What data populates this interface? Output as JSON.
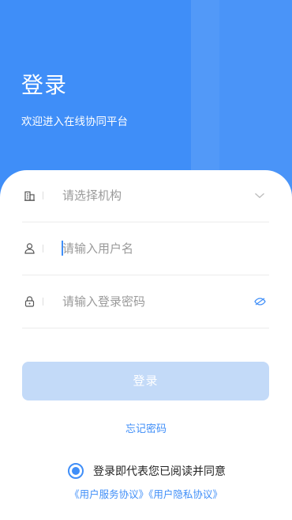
{
  "header": {
    "title": "登录",
    "subtitle": "欢迎进入在线协同平台"
  },
  "form": {
    "org": {
      "placeholder": "请选择机构",
      "icon": "building-icon",
      "trail_icon": "chevron-down-icon"
    },
    "username": {
      "placeholder": "请输入用户名",
      "icon": "user-icon"
    },
    "password": {
      "placeholder": "请输入登录密码",
      "icon": "lock-icon",
      "trail_icon": "eye-closed-icon"
    }
  },
  "actions": {
    "login_label": "登录",
    "forgot_label": "忘记密码"
  },
  "agreement": {
    "text": "登录即代表您已阅读并同意",
    "service_link": "《用户服务协议》",
    "privacy_link": "《用户隐私协议》",
    "checked": true
  },
  "colors": {
    "primary": "#3f8ef8",
    "button_disabled": "#c3daf8"
  }
}
